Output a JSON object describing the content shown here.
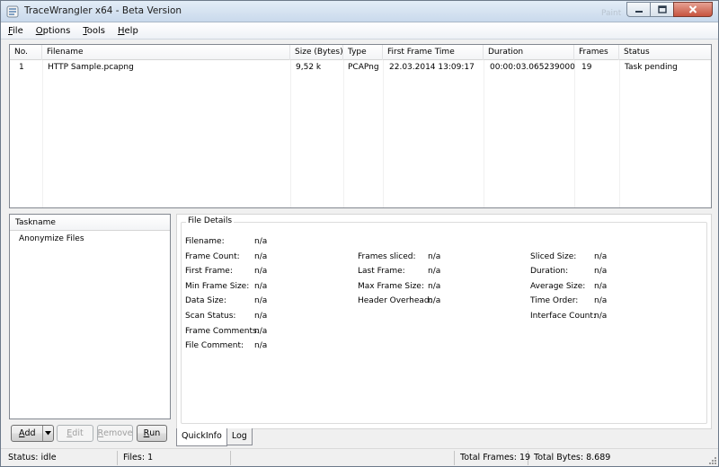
{
  "window": {
    "title": "TraceWrangler x64 - Beta Version",
    "ghost_title": "Paint",
    "controls": {
      "minimize": "minimize-icon",
      "maximize": "maximize-icon",
      "close": "close-icon"
    }
  },
  "menu": [
    {
      "key": "F",
      "rest": "ile"
    },
    {
      "key": "O",
      "rest": "ptions"
    },
    {
      "key": "T",
      "rest": "ools"
    },
    {
      "key": "H",
      "rest": "elp"
    }
  ],
  "filelist": {
    "columns": [
      "No.",
      "Filename",
      "Size (Bytes)",
      "Type",
      "First Frame Time",
      "Duration",
      "Frames",
      "Status"
    ],
    "rows": [
      {
        "no": "1",
        "filename": "HTTP Sample.pcapng",
        "size": "9,52 k",
        "type": "PCAPng",
        "first_frame_time": "22.03.2014 13:09:17",
        "duration": "00:00:03.065239000",
        "frames": "19",
        "status": "Task pending"
      }
    ]
  },
  "tasks": {
    "header": "Taskname",
    "items": [
      "Anonymize Files"
    ]
  },
  "buttons": {
    "add_key": "A",
    "add_rest": "dd",
    "edit_key": "E",
    "edit_rest": "dit",
    "remove_key": "R",
    "remove_rest": "emove",
    "run_key": "R",
    "run_rest": "un"
  },
  "details": {
    "caption": "File Details",
    "col1": [
      {
        "label": "Filename:",
        "value": "n/a"
      },
      {
        "label": "Frame Count:",
        "value": "n/a"
      },
      {
        "label": "First Frame:",
        "value": "n/a"
      },
      {
        "label": "Min Frame Size:",
        "value": "n/a"
      },
      {
        "label": "Data Size:",
        "value": "n/a"
      },
      {
        "label": "Scan Status:",
        "value": "n/a"
      },
      {
        "label": "Frame Comments:",
        "value": "n/a"
      },
      {
        "label": "File Comment:",
        "value": "n/a"
      }
    ],
    "col2": [
      {
        "label": "Frames sliced:",
        "value": "n/a"
      },
      {
        "label": "Last Frame:",
        "value": "n/a"
      },
      {
        "label": "Max Frame Size:",
        "value": "n/a"
      },
      {
        "label": "Header Overhead:",
        "value": "n/a"
      }
    ],
    "col3": [
      {
        "label": "Sliced Size:",
        "value": "n/a"
      },
      {
        "label": "Duration:",
        "value": "n/a"
      },
      {
        "label": "Average Size:",
        "value": "n/a"
      },
      {
        "label": "Time Order:",
        "value": "n/a"
      },
      {
        "label": "Interface Count:",
        "value": "n/a"
      }
    ]
  },
  "tabs": [
    "QuickInfo",
    "Log"
  ],
  "status": {
    "state": "Status: idle",
    "files": "Files: 1",
    "total_frames": "Total Frames: 19",
    "total_bytes": "Total Bytes: 8.689"
  }
}
